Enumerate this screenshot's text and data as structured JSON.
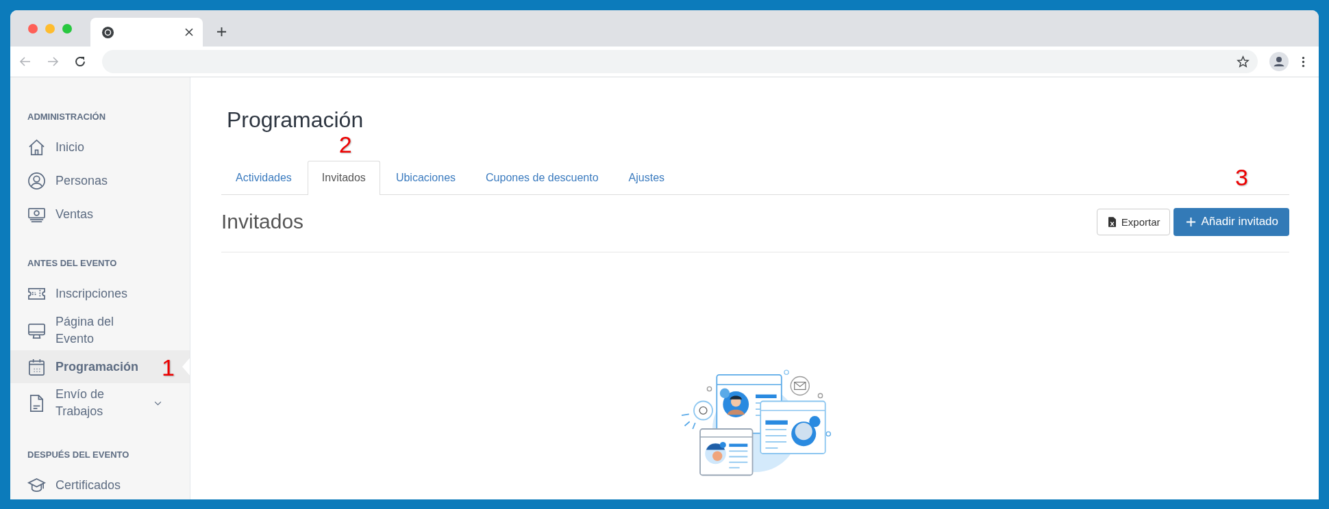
{
  "sidebar": {
    "sections": [
      {
        "title": "ADMINISTRACIÓN",
        "items": [
          {
            "label": "Inicio",
            "selected": false,
            "has_submenu": false
          },
          {
            "label": "Personas",
            "selected": false,
            "has_submenu": false
          },
          {
            "label": "Ventas",
            "selected": false,
            "has_submenu": false
          }
        ]
      },
      {
        "title": "ANTES DEL EVENTO",
        "items": [
          {
            "label": "Inscripciones",
            "selected": false,
            "has_submenu": false
          },
          {
            "label": "Página del Evento",
            "selected": false,
            "has_submenu": false
          },
          {
            "label": "Programación",
            "selected": true,
            "has_submenu": false,
            "annotation": "1"
          },
          {
            "label": "Envío de Trabajos",
            "selected": false,
            "has_submenu": true
          }
        ]
      },
      {
        "title": "DESPUÉS DEL EVENTO",
        "items": [
          {
            "label": "Certificados",
            "selected": false,
            "has_submenu": false
          }
        ]
      }
    ]
  },
  "page": {
    "title": "Programación",
    "tabs": [
      {
        "label": "Actividades",
        "selected": false
      },
      {
        "label": "Invitados",
        "selected": true,
        "annotation": "2"
      },
      {
        "label": "Ubicaciones",
        "selected": false
      },
      {
        "label": "Cupones de descuento",
        "selected": false
      },
      {
        "label": "Ajustes",
        "selected": false
      }
    ],
    "section_title": "Invitados",
    "buttons": [
      {
        "label": "Exportar",
        "kind": "secondary"
      },
      {
        "label": "Añadir invitado",
        "kind": "primary",
        "annotation": "3"
      }
    ]
  }
}
